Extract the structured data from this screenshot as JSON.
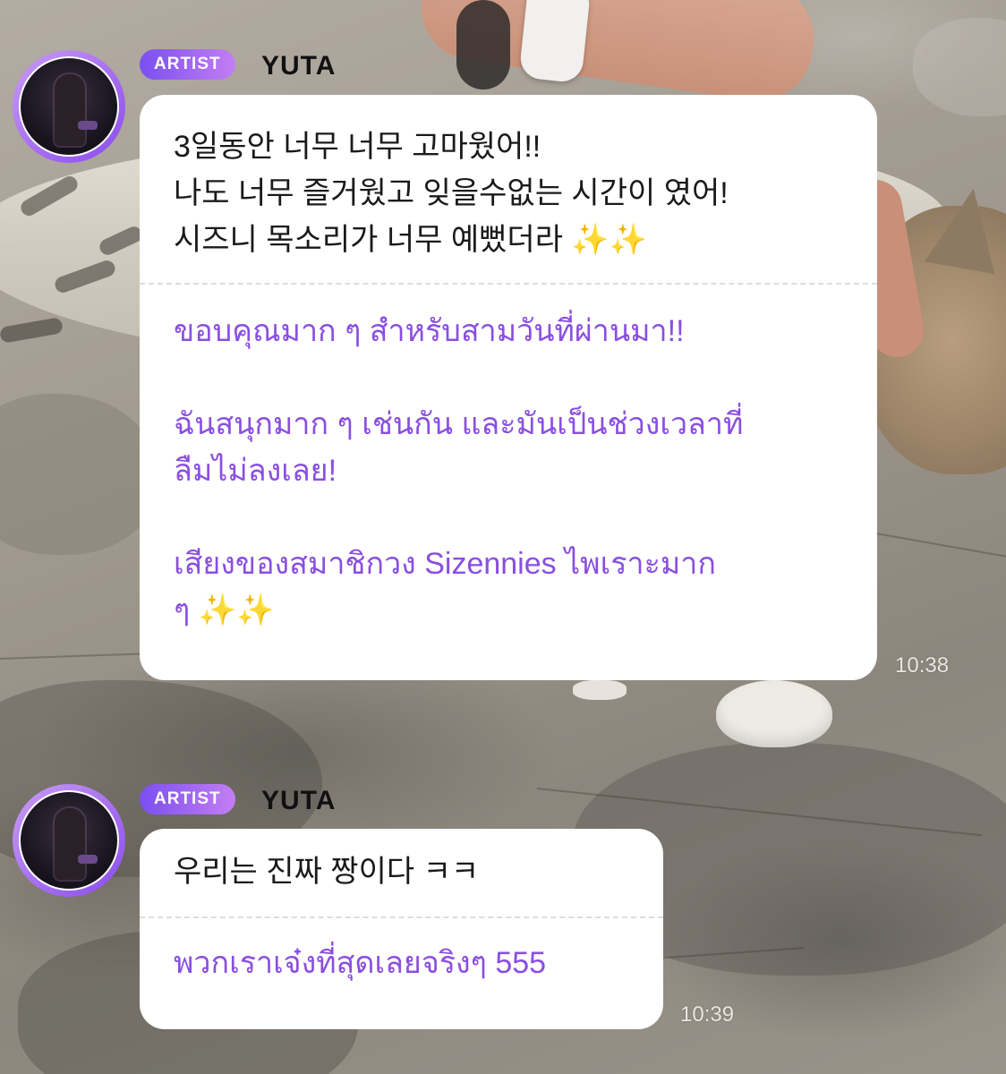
{
  "messages": [
    {
      "badge": "ARTIST",
      "sender": "YUTA",
      "original": "3일동안 너무 너무 고마웠어!!\n나도 너무 즐거웠고 잊을수없는 시간이 였어!\n시즈니 목소리가 너무 예뻤더라 ✨✨",
      "translation_p1": "ขอบคุณมาก ๆ สำหรับสามวันที่ผ่านมา!!",
      "translation_p2": "ฉันสนุกมาก ๆ เช่นกัน และมันเป็นช่วงเวลาที่\nลืมไม่ลงเลย!",
      "translation_p3": "เสียงของสมาชิกวง Sizennies ไพเราะมาก\nๆ ✨✨",
      "time": "10:38"
    },
    {
      "badge": "ARTIST",
      "sender": "YUTA",
      "original": "우리는 진짜 짱이다 ㅋㅋ",
      "translation_p1": "พวกเราเจ๋งที่สุดเลยจริงๆ 555",
      "time": "10:39"
    }
  ],
  "icons": {
    "avatar": "artist-avatar-image"
  },
  "colors": {
    "badge_start": "#7b4ff0",
    "badge_end": "#c37ef3",
    "translation_text": "#8a4fe0"
  }
}
